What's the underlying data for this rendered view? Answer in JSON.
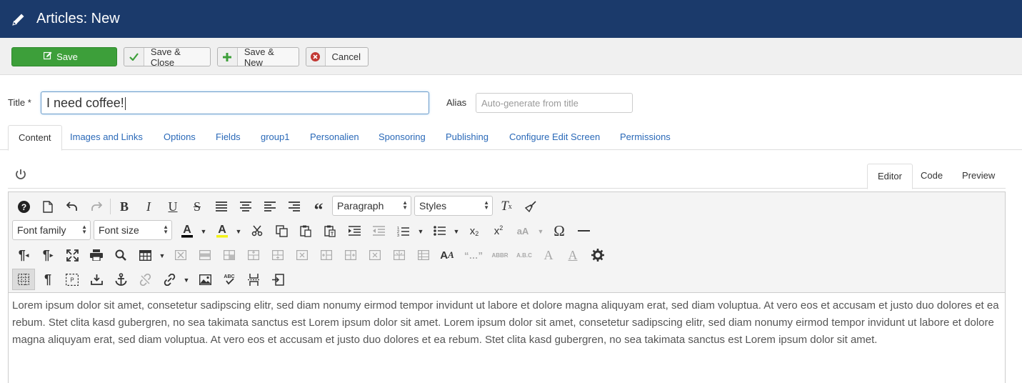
{
  "header": {
    "title": "Articles: New",
    "icon": "pencil-icon"
  },
  "toolbar": {
    "save": "Save",
    "save_close": "Save & Close",
    "save_new": "Save & New",
    "cancel": "Cancel"
  },
  "form": {
    "title_label": "Title *",
    "title_value": "I need coffee!",
    "alias_label": "Alias",
    "alias_placeholder": "Auto-generate from title"
  },
  "tabs": [
    "Content",
    "Images and Links",
    "Options",
    "Fields",
    "group1",
    "Personalien",
    "Sponsoring",
    "Publishing",
    "Configure Edit Screen",
    "Permissions"
  ],
  "editor_modes": [
    "Editor",
    "Code",
    "Preview"
  ],
  "editor_toolbar": {
    "format_select": "Paragraph",
    "styles_select": "Styles",
    "font_family_select": "Font family",
    "font_size_select": "Font size",
    "quote_glyph": "“…”",
    "abbr": "ABBR",
    "abc": "A.B.C"
  },
  "colors": {
    "header_bg": "#1b3a6b",
    "save_bg": "#3d9f3a",
    "link": "#2a69b8"
  },
  "content": {
    "body": "Lorem ipsum dolor sit amet, consetetur sadipscing elitr, sed diam nonumy eirmod tempor invidunt ut labore et dolore magna aliquyam erat, sed diam voluptua. At vero eos et accusam et justo duo dolores et ea rebum. Stet clita kasd gubergren, no sea takimata sanctus est Lorem ipsum dolor sit amet. Lorem ipsum dolor sit amet, consetetur sadipscing elitr, sed diam nonumy eirmod tempor invidunt ut labore et dolore magna aliquyam erat, sed diam voluptua. At vero eos et accusam et justo duo dolores et ea rebum. Stet clita kasd gubergren, no sea takimata sanctus est Lorem ipsum dolor sit amet."
  }
}
